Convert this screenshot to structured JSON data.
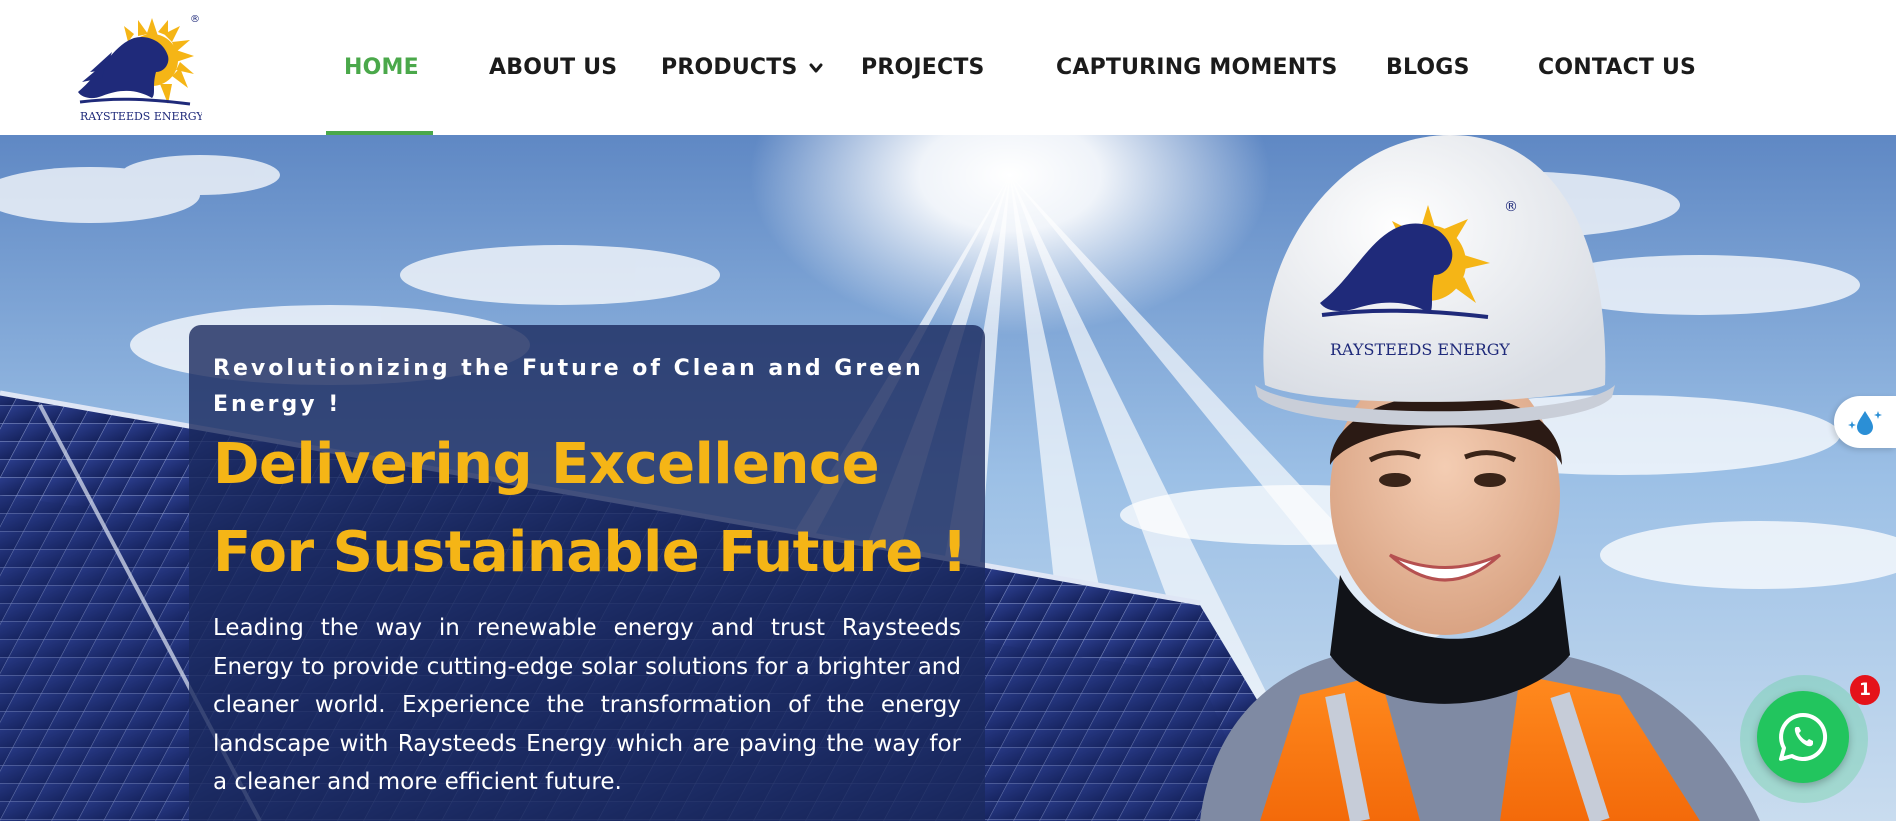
{
  "brand": {
    "name": "RAYSTEEDS ENERGY",
    "registered_mark": "®"
  },
  "nav": {
    "items": [
      {
        "label": "HOME",
        "active": true
      },
      {
        "label": "ABOUT US"
      },
      {
        "label": "PRODUCTS",
        "has_dropdown": true,
        "icon": "chevron-down-icon"
      },
      {
        "label": "PROJECTS"
      },
      {
        "label": "CAPTURING MOMENTS"
      },
      {
        "label": "BLOGS"
      },
      {
        "label": "CONTACT US"
      }
    ]
  },
  "hero": {
    "tagline": "Revolutionizing the Future of Clean and Green Energy !",
    "heading_line1": "Delivering Excellence",
    "heading_line2": "For Sustainable Future !",
    "body": "Leading the way in renewable energy and trust Raysteeds Energy to provide cutting-edge solar solutions for a brighter and cleaner world. Experience the transformation of the energy landscape with Raysteeds Energy which are paving the way for a cleaner and more efficient future.",
    "helmet_logo_text": "RAYSTEEDS ENERGY"
  },
  "widgets": {
    "side_tab_icon": "water-drop-sparkle-icon",
    "whatsapp_icon": "whatsapp-icon",
    "whatsapp_badge_count": "1"
  },
  "colors": {
    "accent_green": "#4aa84a",
    "heading_gold": "#f5b516",
    "panel_navy": "#1a295e",
    "brand_navy": "#1f2a7a",
    "brand_sun": "#f5b516",
    "whatsapp_green": "#22c55e",
    "badge_red": "#e5121a"
  }
}
